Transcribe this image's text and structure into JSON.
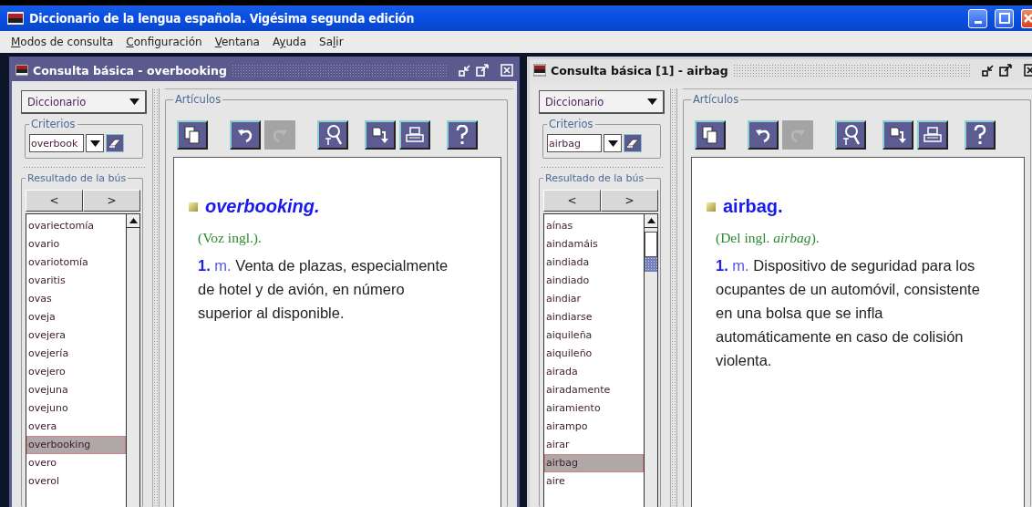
{
  "window": {
    "title": "Diccionario de la lengua española. Vigésima segunda edición"
  },
  "menu": [
    {
      "key": "M",
      "post": "odos de consulta"
    },
    {
      "key": "C",
      "post": "onfiguración"
    },
    {
      "key": "V",
      "post": "entana"
    },
    {
      "pre": "A",
      "key": "y",
      "post": "uda"
    },
    {
      "pre": "Sa",
      "key": "l",
      "post": "ir"
    }
  ],
  "windows": [
    {
      "title": "Consulta básica - overbooking",
      "active": true,
      "source": "Diccionario",
      "criteria_label": "Criterios",
      "query": "overbook",
      "results_label": "Resultado de la bús",
      "nav": [
        "<",
        ">"
      ],
      "thumb_visible": false,
      "results": [
        {
          "text": "ovariectomía",
          "selected": false
        },
        {
          "text": "ovario",
          "selected": false
        },
        {
          "text": "ovariotomía",
          "selected": false
        },
        {
          "text": "ovaritis",
          "selected": false
        },
        {
          "text": "ovas",
          "selected": false
        },
        {
          "text": "oveja",
          "selected": false
        },
        {
          "text": "ovejera",
          "selected": false
        },
        {
          "text": "ovejería",
          "selected": false
        },
        {
          "text": "ovejero",
          "selected": false
        },
        {
          "text": "ovejuna",
          "selected": false
        },
        {
          "text": "ovejuno",
          "selected": false
        },
        {
          "text": "overa",
          "selected": false
        },
        {
          "text": "overbooking",
          "selected": true
        },
        {
          "text": "overo",
          "selected": false
        },
        {
          "text": "overol",
          "selected": false
        }
      ],
      "articles_label": "Artículos",
      "toolbar": [
        {
          "kind": "copy",
          "disabled": false
        },
        {
          "kind": "undo",
          "disabled": false
        },
        {
          "kind": "redo",
          "disabled": true
        },
        {
          "kind": "find",
          "disabled": false
        },
        {
          "kind": "export",
          "disabled": false
        },
        {
          "kind": "print",
          "disabled": false
        },
        {
          "kind": "help",
          "disabled": false
        }
      ],
      "entry": {
        "headword": "overbooking.",
        "headword_italic": true,
        "etymology": "(Voz ingl.).",
        "number": "1.",
        "category": "m.",
        "definition": "Venta de plazas, especialmente de hotel y de avión, en número superior al disponible."
      }
    },
    {
      "title": "Consulta básica [1] - airbag",
      "active": false,
      "source": "Diccionario",
      "criteria_label": "Criterios",
      "query": "airbag",
      "results_label": "Resultado de la bús",
      "nav": [
        "<",
        ">"
      ],
      "thumb_visible": true,
      "results": [
        {
          "text": "aínas",
          "selected": false
        },
        {
          "text": "aindamáis",
          "selected": false
        },
        {
          "text": "aindiada",
          "selected": false
        },
        {
          "text": "aindiado",
          "selected": false
        },
        {
          "text": "aindiar",
          "selected": false
        },
        {
          "text": "aindiarse",
          "selected": false
        },
        {
          "text": "aiquileña",
          "selected": false
        },
        {
          "text": "aiquileño",
          "selected": false
        },
        {
          "text": "airada",
          "selected": false
        },
        {
          "text": "airadamente",
          "selected": false
        },
        {
          "text": "airamiento",
          "selected": false
        },
        {
          "text": "airampo",
          "selected": false
        },
        {
          "text": "airar",
          "selected": false
        },
        {
          "text": "airbag",
          "selected": true
        },
        {
          "text": "aire",
          "selected": false
        }
      ],
      "articles_label": "Artículos",
      "toolbar": [
        {
          "kind": "copy",
          "disabled": false
        },
        {
          "kind": "undo",
          "disabled": false
        },
        {
          "kind": "redo",
          "disabled": true
        },
        {
          "kind": "find",
          "disabled": false
        },
        {
          "kind": "export",
          "disabled": false
        },
        {
          "kind": "print",
          "disabled": false
        },
        {
          "kind": "help",
          "disabled": false
        }
      ],
      "entry": {
        "headword": "airbag.",
        "headword_italic": false,
        "etymology": "(Del ingl. *airbag*).",
        "number": "1.",
        "category": "m.",
        "definition": "Dispositivo de seguridad para los ocupantes de un automóvil, consistente en una bolsa que se infla automáticamente en caso de colisión violenta."
      }
    }
  ]
}
